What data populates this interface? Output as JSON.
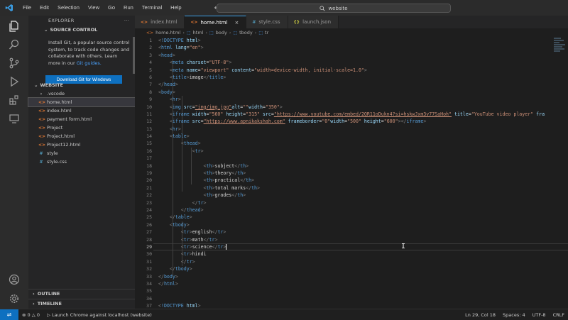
{
  "titlebar": {
    "menu": [
      "File",
      "Edit",
      "Selection",
      "View",
      "Go",
      "Run",
      "Terminal",
      "Help"
    ],
    "search": "website"
  },
  "sidebar": {
    "header": "EXPLORER",
    "more": "···",
    "source_control": "SOURCE CONTROL",
    "git_message": "Install Git, a popular source control system, to track code changes and collaborate with others. Learn more in our",
    "git_link": "Git guides.",
    "git_button": "Download Git for Windows",
    "folder_name": "WEBSITE",
    "tree": [
      {
        "name": ".vscode",
        "type": "folder"
      },
      {
        "name": "home.html",
        "type": "html",
        "selected": true
      },
      {
        "name": "index.html",
        "type": "html"
      },
      {
        "name": "payment form.html",
        "type": "html"
      },
      {
        "name": "Project",
        "type": "html"
      },
      {
        "name": "Project.html",
        "type": "html"
      },
      {
        "name": "Project12.html",
        "type": "html"
      },
      {
        "name": "style",
        "type": "css"
      },
      {
        "name": "style.css",
        "type": "css"
      }
    ],
    "outline": "OUTLINE",
    "timeline": "TIMELINE"
  },
  "tabs": [
    {
      "label": "index.html",
      "type": "html"
    },
    {
      "label": "home.html",
      "type": "html",
      "active": true
    },
    {
      "label": "style.css",
      "type": "css"
    },
    {
      "label": "launch.json",
      "type": "json"
    }
  ],
  "breadcrumb": [
    "home.html",
    "html",
    "body",
    "tbody",
    "tr"
  ],
  "editor": {
    "cursor_line": 29,
    "lines": [
      [
        [
          "br",
          "<"
        ],
        [
          "tag",
          "!DOCTYPE"
        ],
        [
          "attr",
          " html"
        ],
        [
          "br",
          ">"
        ]
      ],
      [
        [
          "br",
          "<"
        ],
        [
          "tag",
          "html"
        ],
        [
          "attr",
          " lang"
        ],
        [
          "txt",
          "="
        ],
        [
          "str",
          "\"en\""
        ],
        [
          "br",
          ">"
        ]
      ],
      [
        [
          "br",
          "<"
        ],
        [
          "tag",
          "head"
        ],
        [
          "br",
          ">"
        ]
      ],
      [
        [
          "txt",
          "    "
        ],
        [
          "br",
          "<"
        ],
        [
          "tag",
          "meta"
        ],
        [
          "attr",
          " charset"
        ],
        [
          "txt",
          "="
        ],
        [
          "str",
          "\"UTF-8\""
        ],
        [
          "br",
          ">"
        ]
      ],
      [
        [
          "txt",
          "    "
        ],
        [
          "br",
          "<"
        ],
        [
          "tag",
          "meta"
        ],
        [
          "attr",
          " name"
        ],
        [
          "txt",
          "="
        ],
        [
          "str",
          "\"viewport\""
        ],
        [
          "attr",
          " content"
        ],
        [
          "txt",
          "="
        ],
        [
          "str",
          "\"width=device-width, initial-scale=1.0\""
        ],
        [
          "br",
          ">"
        ]
      ],
      [
        [
          "txt",
          "    "
        ],
        [
          "br",
          "<"
        ],
        [
          "tag",
          "title"
        ],
        [
          "br",
          ">"
        ],
        [
          "txt",
          "image"
        ],
        [
          "br",
          "</"
        ],
        [
          "tag",
          "title"
        ],
        [
          "br",
          ">"
        ]
      ],
      [
        [
          "br",
          "</"
        ],
        [
          "tag",
          "head"
        ],
        [
          "br",
          ">"
        ]
      ],
      [
        [
          "br",
          "<"
        ],
        [
          "tag",
          "body"
        ],
        [
          "br",
          ">"
        ]
      ],
      [
        [
          "txt",
          "    "
        ],
        [
          "br",
          "<"
        ],
        [
          "tag",
          "hr"
        ],
        [
          "br",
          ">"
        ]
      ],
      [
        [
          "txt",
          "    "
        ],
        [
          "br",
          "<"
        ],
        [
          "tag",
          "img"
        ],
        [
          "attr",
          " src"
        ],
        [
          "txt",
          "="
        ],
        [
          "url",
          "\"img/img.jpg\""
        ],
        [
          "attr",
          "alt"
        ],
        [
          "txt",
          "="
        ],
        [
          "str",
          "\"\""
        ],
        [
          "attr",
          "width"
        ],
        [
          "txt",
          "="
        ],
        [
          "str",
          "\"350\""
        ],
        [
          "br",
          ">"
        ]
      ],
      [
        [
          "txt",
          "    "
        ],
        [
          "br",
          "<"
        ],
        [
          "tag",
          "iframe"
        ],
        [
          "attr",
          " width"
        ],
        [
          "txt",
          "="
        ],
        [
          "str",
          "\"560\""
        ],
        [
          "attr",
          " height"
        ],
        [
          "txt",
          "="
        ],
        [
          "str",
          "\"315\""
        ],
        [
          "attr",
          " src"
        ],
        [
          "txt",
          "="
        ],
        [
          "url",
          "\"https://www.youtube.com/embed/2QR11oDukn4?si=hskwJxm3v77SaHoh\""
        ],
        [
          "attr",
          " title"
        ],
        [
          "txt",
          "="
        ],
        [
          "str",
          "\"YouTube video player\""
        ],
        [
          "attr",
          " fra"
        ]
      ],
      [
        [
          "txt",
          "    "
        ],
        [
          "br",
          "<"
        ],
        [
          "tag",
          "iframe"
        ],
        [
          "attr",
          " src"
        ],
        [
          "txt",
          "="
        ],
        [
          "url",
          "\"https://www.apnikakshah.com\""
        ],
        [
          "attr",
          " frameborder"
        ],
        [
          "txt",
          "="
        ],
        [
          "str",
          "\"0\""
        ],
        [
          "attr",
          "width"
        ],
        [
          "txt",
          "="
        ],
        [
          "str",
          "\"500\""
        ],
        [
          "attr",
          " height"
        ],
        [
          "txt",
          "="
        ],
        [
          "str",
          "\"600\""
        ],
        [
          "br",
          "></"
        ],
        [
          "tag",
          "iframe"
        ],
        [
          "br",
          ">"
        ]
      ],
      [
        [
          "txt",
          "    "
        ],
        [
          "br",
          "<"
        ],
        [
          "tag",
          "hr"
        ],
        [
          "br",
          ">"
        ]
      ],
      [
        [
          "txt",
          "    "
        ],
        [
          "br",
          "<"
        ],
        [
          "tag",
          "table"
        ],
        [
          "br",
          ">"
        ]
      ],
      [
        [
          "txt",
          "        "
        ],
        [
          "br",
          "<"
        ],
        [
          "tag",
          "thead"
        ],
        [
          "br",
          ">"
        ]
      ],
      [
        [
          "txt",
          "            "
        ],
        [
          "br",
          "<"
        ],
        [
          "tag",
          "tr"
        ],
        [
          "br",
          ">"
        ]
      ],
      [
        [
          "txt",
          ""
        ]
      ],
      [
        [
          "txt",
          "                "
        ],
        [
          "br",
          "<"
        ],
        [
          "tag",
          "th"
        ],
        [
          "br",
          ">"
        ],
        [
          "txt",
          "subject"
        ],
        [
          "br",
          "</"
        ],
        [
          "tag",
          "th"
        ],
        [
          "br",
          ">"
        ]
      ],
      [
        [
          "txt",
          "                "
        ],
        [
          "br",
          "<"
        ],
        [
          "tag",
          "th"
        ],
        [
          "br",
          ">"
        ],
        [
          "txt",
          "theory"
        ],
        [
          "br",
          "</"
        ],
        [
          "tag",
          "th"
        ],
        [
          "br",
          ">"
        ]
      ],
      [
        [
          "txt",
          "                "
        ],
        [
          "br",
          "<"
        ],
        [
          "tag",
          "th"
        ],
        [
          "br",
          ">"
        ],
        [
          "txt",
          "practical"
        ],
        [
          "br",
          "</"
        ],
        [
          "tag",
          "th"
        ],
        [
          "br",
          ">"
        ]
      ],
      [
        [
          "txt",
          "                "
        ],
        [
          "br",
          "<"
        ],
        [
          "tag",
          "th"
        ],
        [
          "br",
          ">"
        ],
        [
          "txt",
          "total marks"
        ],
        [
          "br",
          "</"
        ],
        [
          "tag",
          "th"
        ],
        [
          "br",
          ">"
        ]
      ],
      [
        [
          "txt",
          "                "
        ],
        [
          "br",
          "<"
        ],
        [
          "tag",
          "th"
        ],
        [
          "br",
          ">"
        ],
        [
          "txt",
          "grades"
        ],
        [
          "br",
          "</"
        ],
        [
          "tag",
          "th"
        ],
        [
          "br",
          ">"
        ]
      ],
      [
        [
          "txt",
          "            "
        ],
        [
          "br",
          "</"
        ],
        [
          "tag",
          "tr"
        ],
        [
          "br",
          ">"
        ]
      ],
      [
        [
          "txt",
          "        "
        ],
        [
          "br",
          "</"
        ],
        [
          "tag",
          "thead"
        ],
        [
          "br",
          ">"
        ]
      ],
      [
        [
          "txt",
          "    "
        ],
        [
          "br",
          "</"
        ],
        [
          "tag",
          "table"
        ],
        [
          "br",
          ">"
        ]
      ],
      [
        [
          "txt",
          "    "
        ],
        [
          "br",
          "<"
        ],
        [
          "tag",
          "tbody"
        ],
        [
          "br",
          ">"
        ]
      ],
      [
        [
          "txt",
          "        "
        ],
        [
          "br",
          "<"
        ],
        [
          "tag",
          "tr"
        ],
        [
          "br",
          ">"
        ],
        [
          "txt",
          "english"
        ],
        [
          "br",
          "</"
        ],
        [
          "tag",
          "tr"
        ],
        [
          "br",
          ">"
        ]
      ],
      [
        [
          "txt",
          "        "
        ],
        [
          "br",
          "<"
        ],
        [
          "tag",
          "tr"
        ],
        [
          "br",
          ">"
        ],
        [
          "txt",
          "math"
        ],
        [
          "br",
          "</"
        ],
        [
          "tag",
          "tr"
        ],
        [
          "br",
          ">"
        ]
      ],
      [
        [
          "txt",
          "        "
        ],
        [
          "br",
          "<"
        ],
        [
          "tag",
          "tr"
        ],
        [
          "br",
          ">"
        ],
        [
          "txt",
          "science"
        ],
        [
          "br",
          "</"
        ],
        [
          "tag",
          "tr"
        ],
        [
          "br",
          ">"
        ]
      ],
      [
        [
          "txt",
          "        "
        ],
        [
          "br",
          "<"
        ],
        [
          "tag",
          "tr"
        ],
        [
          "br",
          ">"
        ],
        [
          "txt",
          "hindi"
        ]
      ],
      [
        [
          "txt",
          "        "
        ],
        [
          "br",
          "</"
        ],
        [
          "tag",
          "tr"
        ],
        [
          "br",
          ">"
        ]
      ],
      [
        [
          "txt",
          "    "
        ],
        [
          "br",
          "</"
        ],
        [
          "tag",
          "tbody"
        ],
        [
          "br",
          ">"
        ]
      ],
      [
        [
          "br",
          "</"
        ],
        [
          "tag",
          "body"
        ],
        [
          "br",
          ">"
        ]
      ],
      [
        [
          "br",
          "</"
        ],
        [
          "tag",
          "html"
        ],
        [
          "br",
          ">"
        ]
      ],
      [
        [
          "txt",
          ""
        ]
      ],
      [
        [
          "txt",
          ""
        ]
      ],
      [
        [
          "br",
          "<"
        ],
        [
          "tag",
          "!DOCTYPE"
        ],
        [
          "attr",
          " html"
        ],
        [
          "br",
          ">"
        ]
      ]
    ]
  },
  "statusbar": {
    "errors": "0",
    "warnings": "0",
    "launch": "Launch Chrome against localhost (website)",
    "position": "Ln 29, Col 18",
    "spaces": "Spaces: 4",
    "encoding": "UTF-8",
    "eol": "CRLF"
  },
  "colors": {
    "accent": "#0e70c0",
    "html_icon": "#e37933",
    "css_icon": "#519aba",
    "tag": "#569cd6",
    "attribute": "#9cdcfe",
    "string": "#ce9178"
  }
}
